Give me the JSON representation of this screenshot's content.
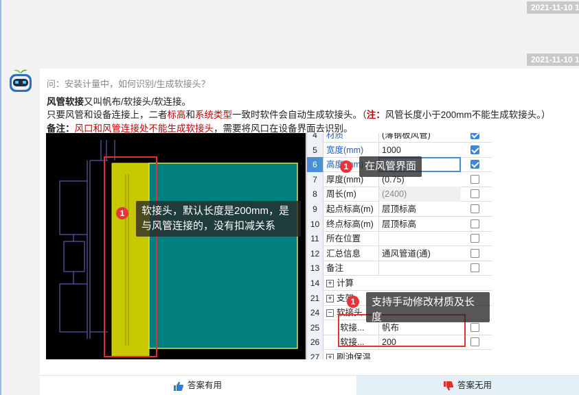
{
  "timestamps": [
    "2021-11-10 1",
    "2021-11-10 1"
  ],
  "question": "问：安装计量中，如何识别/生成软接头？",
  "answer": {
    "l1_bold": "风管软接",
    "l1_rest": "又叫帆布/软接头/软连接。",
    "l2_a": "只要风管和设备连接上，二者",
    "l2_red1": "标高",
    "l2_b": "和",
    "l2_red2": "系统类型",
    "l2_c": "一致时软件会自动生成软接头。（",
    "l2_note_label": "注：",
    "l2_d": "风管长度小于200mm不能生成软接头。）",
    "l3_label": "备注：",
    "l3_red": "风口和风管连接处不能生成软接头",
    "l3_rest": "，需要将风口在设备界面去识别。"
  },
  "properties": [
    {
      "num": "4",
      "name": "材质",
      "value": "(薄钢板风管)",
      "checked": true,
      "name_blue": true
    },
    {
      "num": "5",
      "name": "宽度(mm)",
      "value": "1000",
      "checked": true,
      "name_blue": true
    },
    {
      "num": "6",
      "name": "高度(mm)",
      "value": "",
      "checked": true,
      "name_blue": true,
      "selected": true,
      "editing": true
    },
    {
      "num": "7",
      "name": "厚度(mm)",
      "value": "(0.75)",
      "checked": false
    },
    {
      "num": "8",
      "name": "周长(m)",
      "value": "(2400)",
      "checked": false,
      "gray": true
    },
    {
      "num": "9",
      "name": "起点标高(m)",
      "value": "层顶标高",
      "checked": false
    },
    {
      "num": "10",
      "name": "终点标高(m)",
      "value": "层顶标高",
      "checked": false
    },
    {
      "num": "11",
      "name": "所在位置",
      "value": "",
      "checked": false
    },
    {
      "num": "12",
      "name": "汇总信息",
      "value": "通风管道(通)",
      "checked": false
    },
    {
      "num": "13",
      "name": "备注",
      "value": "",
      "checked": false
    },
    {
      "num": "14",
      "name": "计算",
      "expander": "+",
      "group": true
    },
    {
      "num": "21",
      "name": "支架",
      "expander": "+",
      "group": true
    },
    {
      "num": "24",
      "name": "软接头",
      "expander": "−",
      "group": true
    },
    {
      "num": "25",
      "name": "软接...",
      "value": "帆布",
      "checked": false,
      "indent": true
    },
    {
      "num": "26",
      "name": "软接...",
      "value": "200",
      "checked": false,
      "indent": true
    },
    {
      "num": "27",
      "name": "刷油保温",
      "expander": "+",
      "group": true
    }
  ],
  "tips": {
    "badge": "1",
    "tip1": "软接头，默认长度是200mm，是与风管连接的，没有扣减关系",
    "tip2": "在风管界面",
    "tip3": "支持手动修改材质及长度"
  },
  "votes": {
    "useful": "答案有用",
    "useless": "答案无用"
  },
  "colors": {
    "accent_red": "#c00000",
    "duct_teal": "#007f7f",
    "flex_yellow": "#c8c800",
    "vote_no_bg": "#e3f0f8"
  }
}
